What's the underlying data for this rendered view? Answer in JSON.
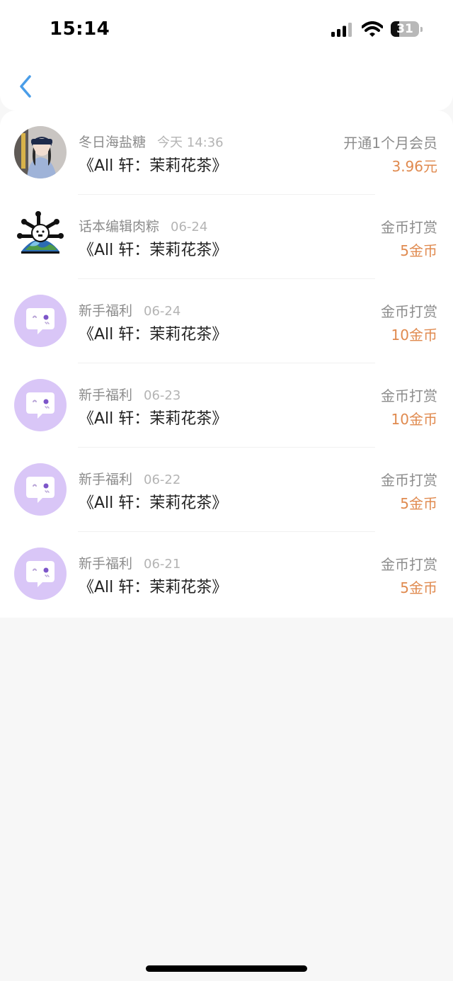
{
  "status_bar": {
    "time": "15:14",
    "battery_level": "31"
  },
  "colors": {
    "amount": "#e08a4f",
    "accent": "#4a9de8",
    "gray_text": "#8c8c8c",
    "mascot_bg": "#d9c6f7"
  },
  "records": [
    {
      "user": "冬日海盐糖",
      "date": "今天 14:36",
      "title": "《All 轩：茉莉花茶》",
      "type": "开通1个月会员",
      "amount": "3.96元",
      "avatar_icon": "photo-girl-avatar"
    },
    {
      "user": "话本编辑肉粽",
      "date": "06-24",
      "title": "《All 轩：茉莉花茶》",
      "type": "金币打赏",
      "amount": "5金币",
      "avatar_icon": "earth-bones-avatar"
    },
    {
      "user": "新手福利",
      "date": "06-24",
      "title": "《All 轩：茉莉花茶》",
      "type": "金币打赏",
      "amount": "10金币",
      "avatar_icon": "chat-bubble-mascot-icon"
    },
    {
      "user": "新手福利",
      "date": "06-23",
      "title": "《All 轩：茉莉花茶》",
      "type": "金币打赏",
      "amount": "10金币",
      "avatar_icon": "chat-bubble-mascot-icon"
    },
    {
      "user": "新手福利",
      "date": "06-22",
      "title": "《All 轩：茉莉花茶》",
      "type": "金币打赏",
      "amount": "5金币",
      "avatar_icon": "chat-bubble-mascot-icon"
    },
    {
      "user": "新手福利",
      "date": "06-21",
      "title": "《All 轩：茉莉花茶》",
      "type": "金币打赏",
      "amount": "5金币",
      "avatar_icon": "chat-bubble-mascot-icon"
    }
  ]
}
